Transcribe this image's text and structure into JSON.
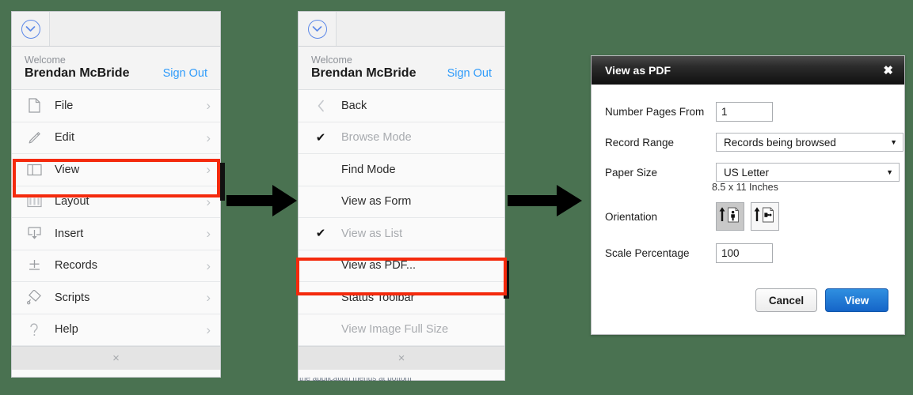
{
  "background_color": "#4a7251",
  "accent_color": "#f42a0d",
  "link_color": "#2f9bfa",
  "menu_panel_1": {
    "topbar_icon": "chevron-down-circle-icon",
    "welcome_label": "Welcome",
    "user_name": "Brendan McBride",
    "sign_out_label": "Sign Out",
    "items": [
      {
        "label": "File",
        "icon": "document-icon",
        "chevron": "›",
        "dimmed": false,
        "checked": false
      },
      {
        "label": "Edit",
        "icon": "pencil-icon",
        "chevron": "›",
        "dimmed": false,
        "checked": false
      },
      {
        "label": "View",
        "icon": "panels-icon",
        "chevron": "›",
        "dimmed": false,
        "checked": false,
        "highlighted": true
      },
      {
        "label": "Layout",
        "icon": "filmstrip-icon",
        "chevron": "›",
        "dimmed": false,
        "checked": false
      },
      {
        "label": "Insert",
        "icon": "insert-box-icon",
        "chevron": "›",
        "dimmed": false,
        "checked": false
      },
      {
        "label": "Records",
        "icon": "plus-line-icon",
        "chevron": "›",
        "dimmed": false,
        "checked": false
      },
      {
        "label": "Scripts",
        "icon": "stamp-icon",
        "chevron": "›",
        "dimmed": false,
        "checked": false
      },
      {
        "label": "Help",
        "icon": "question-mark-icon",
        "chevron": "›",
        "dimmed": false,
        "checked": false
      }
    ],
    "footer_close": "×"
  },
  "menu_panel_2": {
    "topbar_icon": "chevron-down-circle-icon",
    "welcome_label": "Welcome",
    "user_name": "Brendan McBride",
    "sign_out_label": "Sign Out",
    "items": [
      {
        "label": "Back",
        "icon": "chevron-left-icon",
        "dimmed": false,
        "checked": false
      },
      {
        "label": "Browse Mode",
        "icon": "",
        "dimmed": true,
        "checked": true
      },
      {
        "label": "Find Mode",
        "icon": "",
        "dimmed": false,
        "checked": false
      },
      {
        "label": "View as Form",
        "icon": "",
        "dimmed": false,
        "checked": false
      },
      {
        "label": "View as List",
        "icon": "",
        "dimmed": true,
        "checked": true
      },
      {
        "label": "View as PDF...",
        "icon": "",
        "dimmed": false,
        "checked": false,
        "highlighted": true
      },
      {
        "label": "Status Toolbar",
        "icon": "",
        "dimmed": false,
        "checked": false
      },
      {
        "label": "View Image Full Size",
        "icon": "",
        "dimmed": true,
        "checked": false
      }
    ],
    "footer_close": "×"
  },
  "arrows": [
    {
      "name": "arrow-panel1-to-panel2"
    },
    {
      "name": "arrow-panel2-to-dialog"
    }
  ],
  "dialog": {
    "title": "View as PDF",
    "close_label": "✖",
    "fields": {
      "number_pages_from_label": "Number Pages From",
      "number_pages_from_value": "1",
      "record_range_label": "Record Range",
      "record_range_value": "Records being browsed",
      "paper_size_label": "Paper Size",
      "paper_size_value": "US Letter",
      "paper_size_note": "8.5 x 11 Inches",
      "orientation_label": "Orientation",
      "orientation_portrait": "portrait-orientation-icon",
      "orientation_landscape": "landscape-orientation-icon",
      "orientation_selected": "portrait",
      "scale_percentage_label": "Scale Percentage",
      "scale_percentage_value": "100"
    },
    "buttons": {
      "cancel_label": "Cancel",
      "view_label": "View"
    },
    "dropdown_caret": "▼"
  }
}
